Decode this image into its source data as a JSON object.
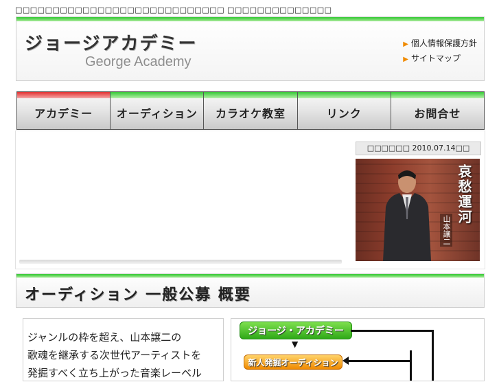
{
  "top_text": "□□□□□□□□□□□□□□□□□□□□□□□□□□□□ □□□□□□□□□□□□□□",
  "header": {
    "logo_ja": "ジョージアカデミー",
    "logo_en": "George Academy",
    "links": [
      "個人情報保護方針",
      "サイトマップ"
    ]
  },
  "nav": {
    "items": [
      "アカデミー",
      "オーディション",
      "カラオケ教室",
      "リンク",
      "お問合せ"
    ]
  },
  "news": {
    "label": "□□□□□□  2010.07.14□□"
  },
  "cd": {
    "title": "哀愁運河",
    "artist": "山本譲二"
  },
  "section": {
    "title": "オーディション  一般公募  概要"
  },
  "intro_text": {
    "lines": [
      "ジャンルの枠を超え、山本譲二の",
      "歌魂を継承する次世代アーティストを",
      "発掘すべく立ち上がった音楽レーベル"
    ]
  },
  "flow": {
    "green_label": "ジョージ・アカデミー",
    "orange_label": "新人発掘オーディション"
  },
  "colors": {
    "accent_green": "#2fc82f",
    "accent_red": "#e23030",
    "accent_orange": "#f08a00"
  }
}
